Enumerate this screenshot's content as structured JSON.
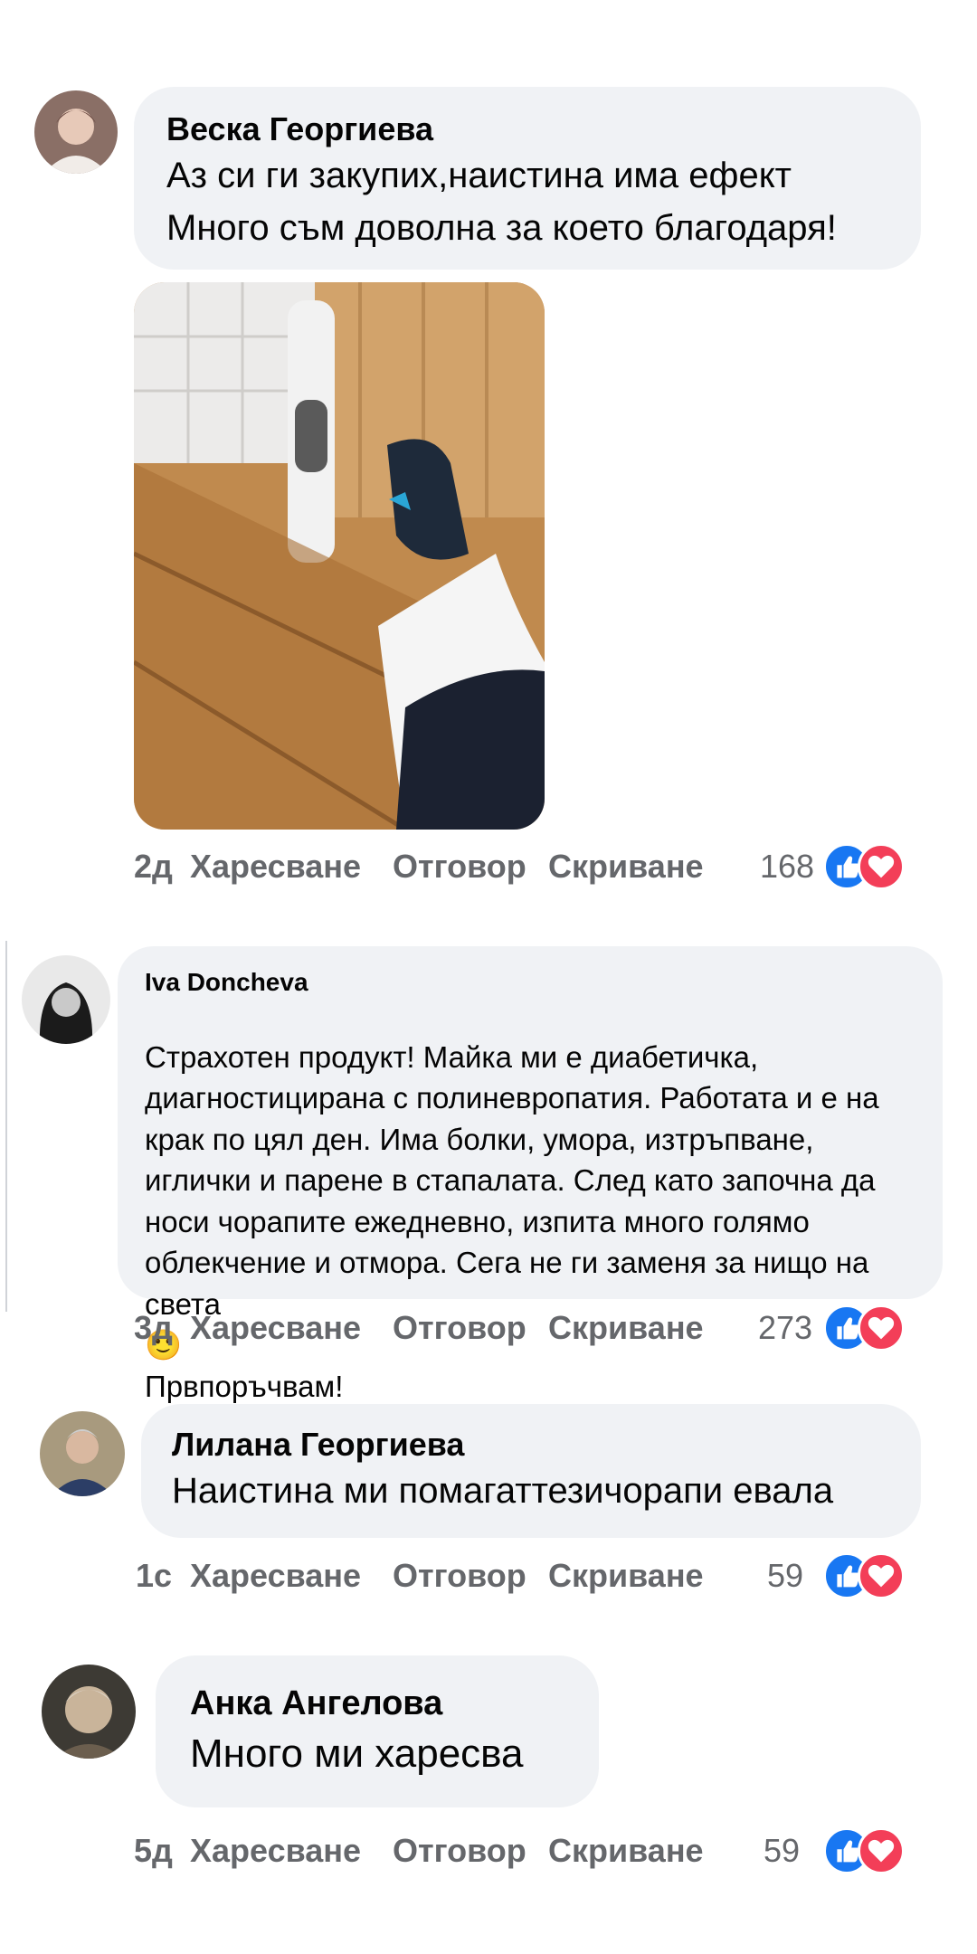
{
  "comments": [
    {
      "author": "Веска Георгиева",
      "lines": [
        "Аз си ги закупих,наистина има ефект",
        "Много съм доволна за което благодаря!"
      ],
      "time": "2д",
      "like": "Харесване",
      "reply": "Отговор",
      "hide": "Скриване",
      "count": "168"
    },
    {
      "author": "Iva Doncheva",
      "text": "Страхотен продукт! Майка ми е диабетичка,\nдиагностицирана с полиневропатия. Работата и е на\nкрак по цял ден. Има болки, умора, изтръпване,\nиглички и парене в стапалата. След като започна да\nноси чорапите ежедневно, изпита много голямо\nоблекчение и отмора. Сега не ги заменя за нищо на\nсвета",
      "text_end": "Првпоръчвам!",
      "emoji": "🙂",
      "time": "3д",
      "like": "Харесване",
      "reply": "Отговор",
      "hide": "Скриване",
      "count": "273"
    },
    {
      "author": "Лилана Георгиева",
      "text": "Наистина ми помагаттезичорапи евала",
      "time": "1с",
      "like": "Харесване",
      "reply": "Отговор",
      "hide": "Скриване",
      "count": "59"
    },
    {
      "author": "Анка Ангелова",
      "text": "Много ми харесва",
      "time": "5д",
      "like": "Харесване",
      "reply": "Отговор",
      "hide": "Скриване",
      "count": "59"
    }
  ],
  "icons": {
    "like": "thumbs-up-icon",
    "love": "heart-icon"
  },
  "colors": {
    "bubble": "#f0f2f5",
    "meta": "#65676b",
    "like": "#1877f2",
    "love": "#f33e58"
  }
}
